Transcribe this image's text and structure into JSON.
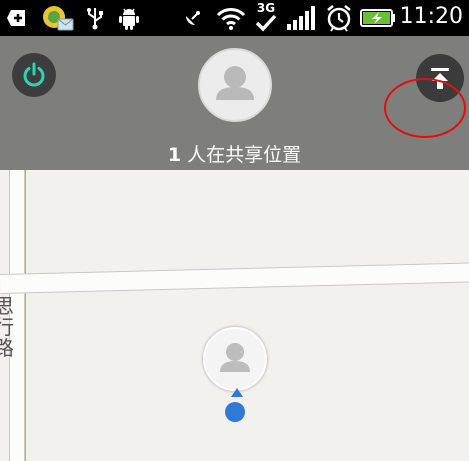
{
  "status_bar": {
    "time": "11:20",
    "network": "3G",
    "icons": [
      "add-icon",
      "app-icon",
      "usb-icon",
      "android-debug-icon",
      "satellite-icon",
      "wifi-icon",
      "network-3g-icon",
      "signal-icon",
      "alarm-icon",
      "battery-charging-icon"
    ]
  },
  "header": {
    "share_count": "1",
    "share_text": "人在共享位置"
  },
  "map": {
    "street_label": "思 行 路"
  },
  "colors": {
    "header_bg": "#7e7e7d",
    "power_accent": "#2fd2b4",
    "location_blue": "#2e7ad6",
    "annotation_red": "#e01010"
  }
}
